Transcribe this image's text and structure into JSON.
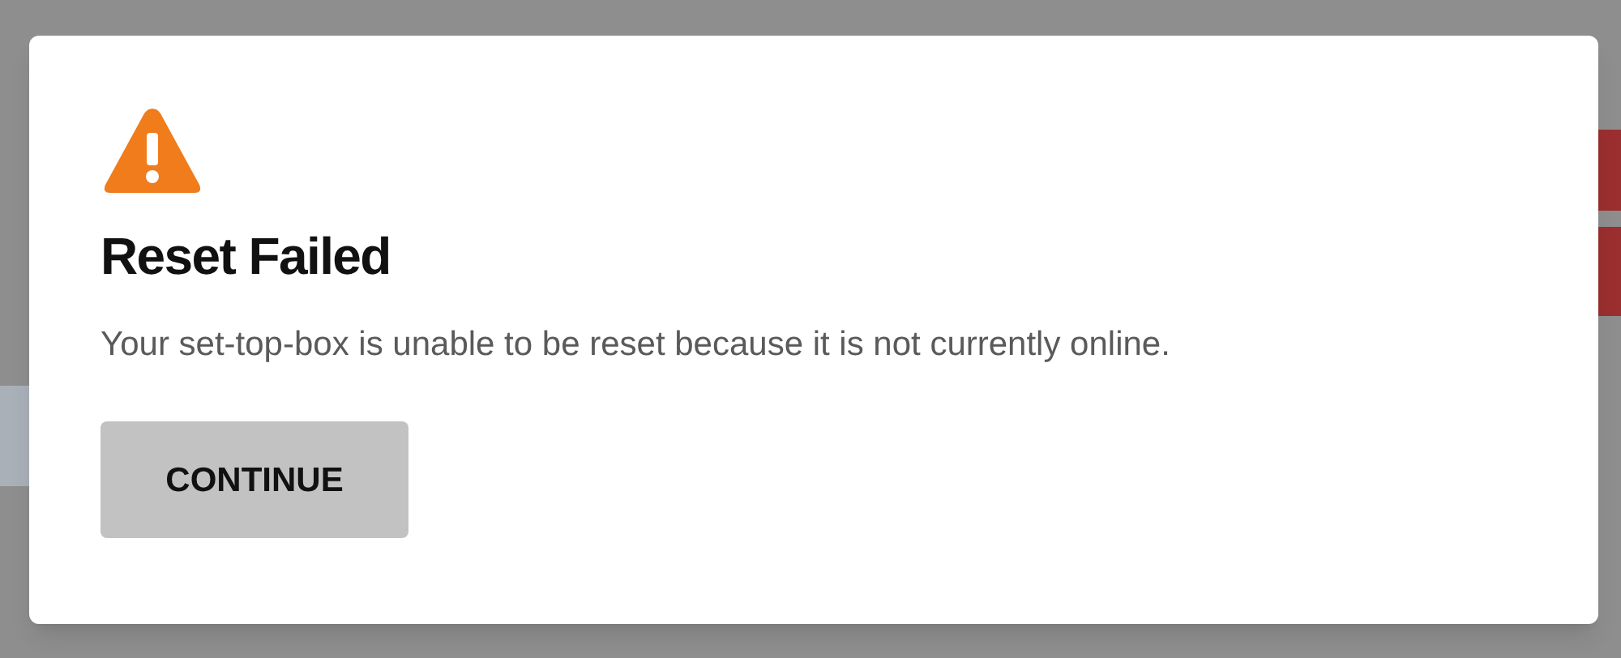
{
  "dialog": {
    "title": "Reset Failed",
    "message": "Your set-top-box is unable to be reset because it is not currently online.",
    "buttons": [
      "CONTINUE"
    ]
  }
}
